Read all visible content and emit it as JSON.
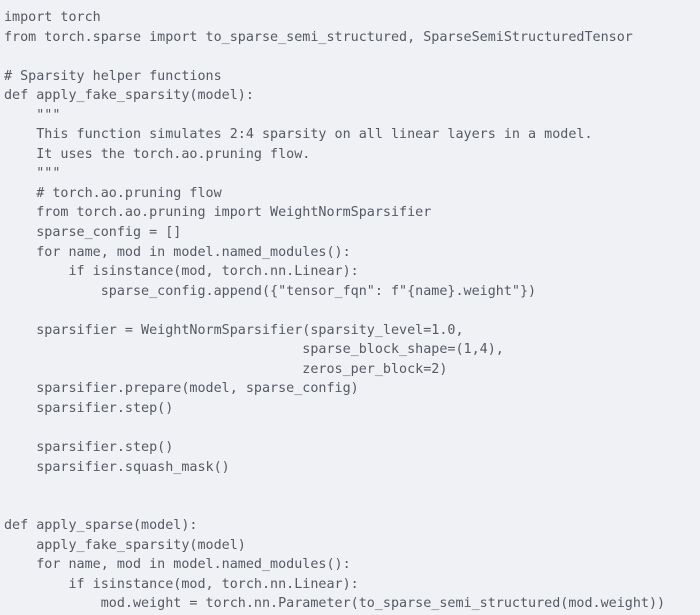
{
  "code_block": {
    "language": "python",
    "background_color": "#f0f1f5",
    "text_color": "#555a63",
    "line_count": 31,
    "lines": [
      "import torch",
      "from torch.sparse import to_sparse_semi_structured, SparseSemiStructuredTensor",
      "",
      "# Sparsity helper functions",
      "def apply_fake_sparsity(model):",
      "    \"\"\"",
      "    This function simulates 2:4 sparsity on all linear layers in a model.",
      "    It uses the torch.ao.pruning flow.",
      "    \"\"\"",
      "    # torch.ao.pruning flow",
      "    from torch.ao.pruning import WeightNormSparsifier",
      "    sparse_config = []",
      "    for name, mod in model.named_modules():",
      "        if isinstance(mod, torch.nn.Linear):",
      "            sparse_config.append({\"tensor_fqn\": f\"{name}.weight\"})",
      "",
      "    sparsifier = WeightNormSparsifier(sparsity_level=1.0,",
      "                                     sparse_block_shape=(1,4),",
      "                                     zeros_per_block=2)",
      "    sparsifier.prepare(model, sparse_config)",
      "    sparsifier.step()",
      "",
      "    sparsifier.step()",
      "    sparsifier.squash_mask()",
      "",
      "",
      "def apply_sparse(model):",
      "    apply_fake_sparsity(model)",
      "    for name, mod in model.named_modules():",
      "        if isinstance(mod, torch.nn.Linear):",
      "            mod.weight = torch.nn.Parameter(to_sparse_semi_structured(mod.weight))"
    ]
  }
}
